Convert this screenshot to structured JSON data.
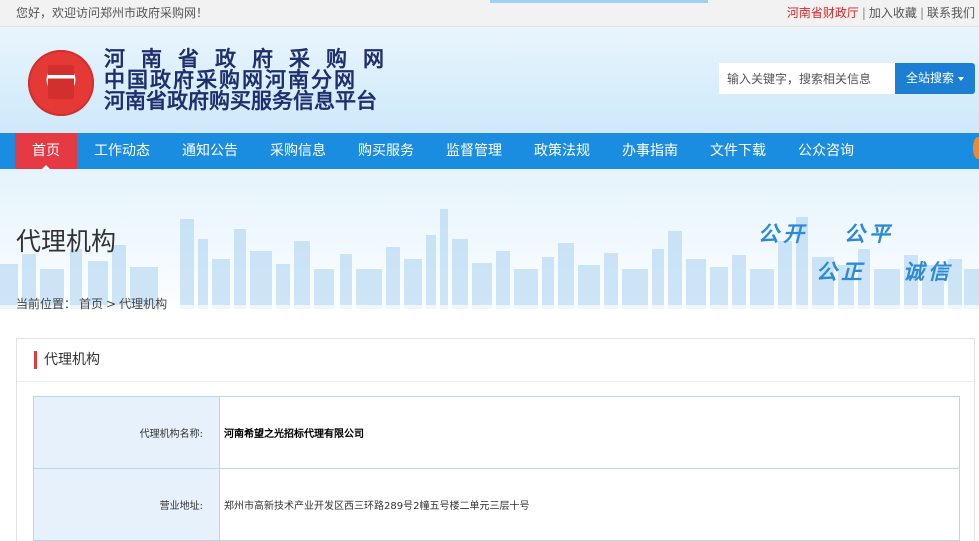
{
  "topbar": {
    "welcome": "您好，欢迎访问郑州市政府采购网！",
    "link_finance": "河南省财政厅",
    "link_favorite": "加入收藏",
    "link_contact": "联系我们",
    "separator": "|"
  },
  "header": {
    "title_line1": "河南省政府采购网",
    "title_line2": "中国政府采购网河南分网",
    "title_line3": "河南省政府购买服务信息平台",
    "search_placeholder": "输入关键字，搜索相关信息",
    "search_button": "全站搜索"
  },
  "nav": {
    "items": [
      "首页",
      "工作动态",
      "通知公告",
      "采购信息",
      "购买服务",
      "监督管理",
      "政策法规",
      "办事指南",
      "文件下载",
      "公众咨询"
    ]
  },
  "banner": {
    "page_title": "代理机构",
    "breadcrumb": [
      "当前位置：",
      "首页",
      ">",
      "代理机构"
    ],
    "slogans": [
      "公开",
      "公平",
      "公正",
      "诚信"
    ]
  },
  "content": {
    "section_title": "代理机构",
    "rows": [
      {
        "label": "代理机构名称:",
        "value": "河南希望之光招标代理有限公司"
      },
      {
        "label": "营业地址:",
        "value": "郑州市高新技术产业开发区西三环路289号2幢五号楼二单元三层十号"
      }
    ]
  },
  "colors": {
    "nav_bg": "#1a8de0",
    "nav_active": "#e53944",
    "title_text": "#1f2f6e",
    "table_border": "#b9d6ee",
    "label_bg": "#e6f1fc"
  }
}
